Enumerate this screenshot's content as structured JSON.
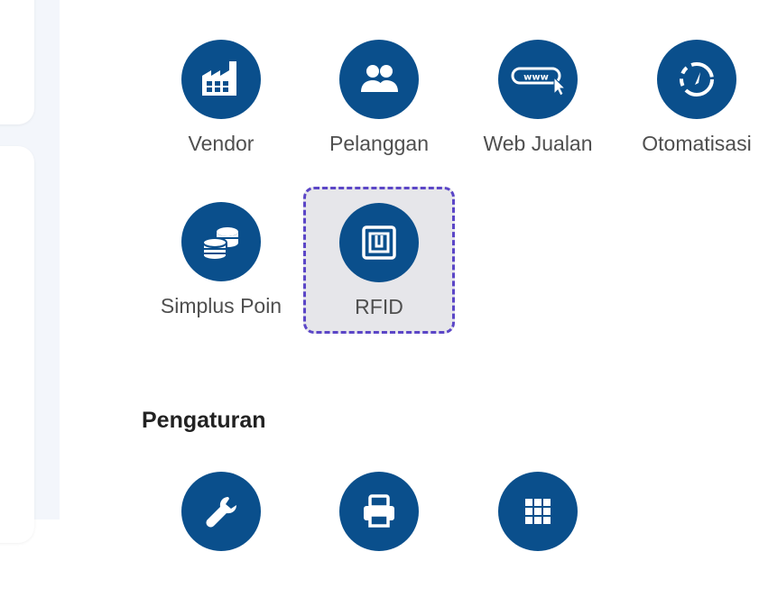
{
  "features": [
    {
      "label": "Vendor",
      "icon": "factory-icon"
    },
    {
      "label": "Pelanggan",
      "icon": "users-icon"
    },
    {
      "label": "Web Jualan",
      "icon": "www-icon"
    },
    {
      "label": "Otomatisasi",
      "icon": "automation-icon"
    },
    {
      "label": "Simplus Poin",
      "icon": "coins-icon"
    },
    {
      "label": "RFID",
      "icon": "rfid-icon",
      "selected": true
    }
  ],
  "settings": {
    "title": "Pengaturan",
    "items": [
      {
        "icon": "wrench-icon"
      },
      {
        "icon": "printer-icon"
      },
      {
        "icon": "grid-icon"
      }
    ]
  },
  "colors": {
    "icon_circle": "#0a4f8c",
    "selection_border": "#5b46c7",
    "label_text": "#4f4f4f"
  }
}
